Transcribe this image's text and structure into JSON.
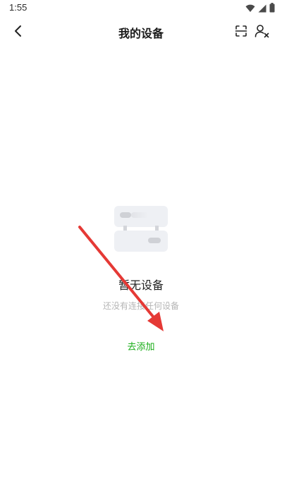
{
  "status_bar": {
    "time": "1:55",
    "icons": [
      "wifi-icon",
      "signal-icon",
      "battery-icon"
    ]
  },
  "nav": {
    "title": "我的设备",
    "back_icon": "chevron-left-icon",
    "scan_icon": "scan-icon",
    "user_icon": "user-remove-icon"
  },
  "empty_state": {
    "illustration_icon": "device-server-icon",
    "title": "暂无设备",
    "subtitle": "还没有连接任何设备",
    "action_label": "去添加"
  },
  "colors": {
    "accent": "#1aad19",
    "annotation": "#e53935",
    "muted_text": "#b5b5b5"
  }
}
